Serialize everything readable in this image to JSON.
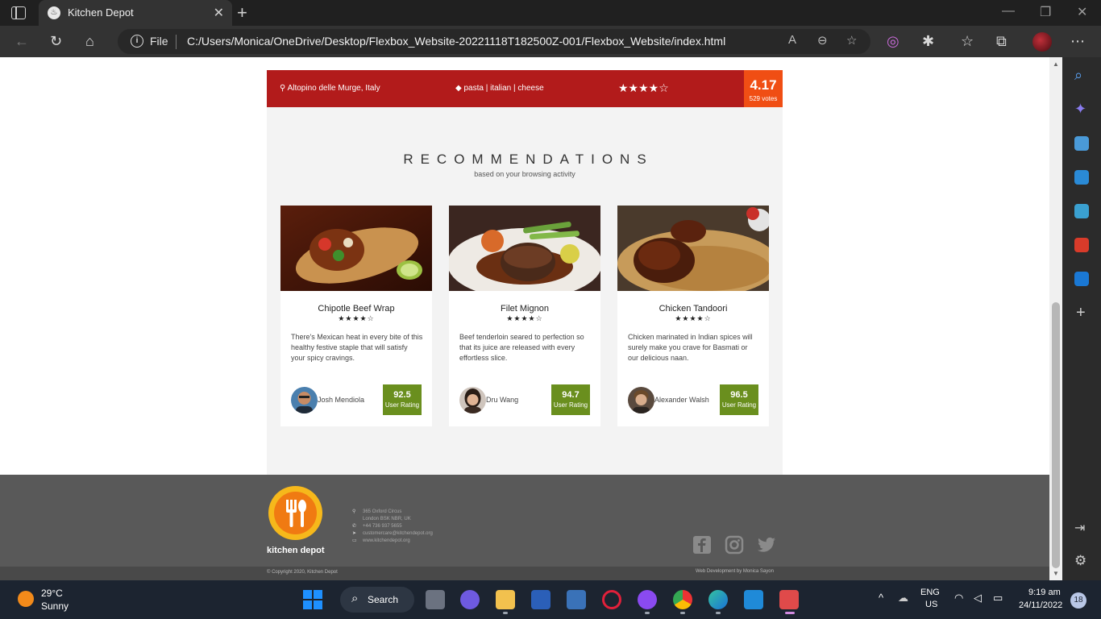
{
  "browser": {
    "tab_title": "Kitchen Depot",
    "tab_favicon": "fork-knife-icon",
    "url_scheme_label": "File",
    "url": "C:/Users/Monica/OneDrive/Desktop/Flexbox_Website-20221118T182500Z-001/Flexbox_Website/index.html"
  },
  "info_bar": {
    "location": "Altopino delle Murge, Italy",
    "tags": "pasta | italian | cheese",
    "stars": "★★★★☆",
    "score": "4.17",
    "votes": "529 votes",
    "color": "#b21b1b",
    "score_color": "#f04e14"
  },
  "recommendations": {
    "title": "RECOMMENDATIONS",
    "subtitle": "based on your browsing activity",
    "cards": [
      {
        "name": "Chipotle Beef Wrap",
        "stars": "★★★★☆",
        "description": "There's Mexican heat in every bite of this healthy festive staple that will satisfy your spicy cravings.",
        "author": "Josh Mendiola",
        "rating": "92.5",
        "rating_label": "User Rating"
      },
      {
        "name": "Filet Mignon",
        "stars": "★★★★☆",
        "description": "Beef tenderloin seared to perfection so that its juice are released with every effortless slice.",
        "author": "Dru Wang",
        "rating": "94.7",
        "rating_label": "User Rating"
      },
      {
        "name": "Chicken Tandoori",
        "stars": "★★★★☆",
        "description": "Chicken marinated in Indian spices will surely make you crave for Basmati or our delicious naan.",
        "author": "Alexander Walsh",
        "rating": "96.5",
        "rating_label": "User Rating"
      }
    ]
  },
  "footer": {
    "brand": "kitchen depot",
    "address_1": "365 Oxford Circus",
    "address_2": "London BSK NBR, UK",
    "phone": "+44 736 937 5655",
    "email": "customercare@kitchendepot.org",
    "website": "www.kitchendepot.org",
    "copyright": "© Copyright 2020, Kitchen Depot",
    "credit": "Web Development by Monica Sayon"
  },
  "taskbar": {
    "temperature": "29°C",
    "weather": "Sunny",
    "search_label": "Search",
    "lang_1": "ENG",
    "lang_2": "US",
    "time": "9:19 am",
    "date": "24/11/2022",
    "notifications": "18"
  }
}
